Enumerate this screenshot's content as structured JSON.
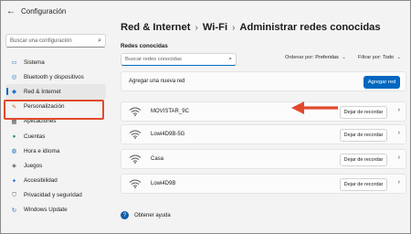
{
  "window": {
    "title": "Configuración",
    "back_glyph": "←"
  },
  "sidebar": {
    "search_placeholder": "Buscar una configuración",
    "items": [
      {
        "label": "Sistema",
        "icon": "monitor-icon",
        "glyph": "▭",
        "color": "#2b79d1"
      },
      {
        "label": "Bluetooth y dispositivos",
        "icon": "bluetooth-icon",
        "glyph": "◎",
        "color": "#2b79d1"
      },
      {
        "label": "Red & Internet",
        "icon": "wifi-diamond-icon",
        "glyph": "◆",
        "color": "#1d6fc7",
        "active": true
      },
      {
        "label": "Personalización",
        "icon": "brush-icon",
        "glyph": "✎",
        "color": "#c46a2a"
      },
      {
        "label": "Aplicaciones",
        "icon": "apps-icon",
        "glyph": "▦",
        "color": "#5a5a5a"
      },
      {
        "label": "Cuentas",
        "icon": "person-icon",
        "glyph": "●",
        "color": "#2f9e5a"
      },
      {
        "label": "Hora e idioma",
        "icon": "globe-clock-icon",
        "glyph": "◍",
        "color": "#1d6fc7"
      },
      {
        "label": "Juegos",
        "icon": "controller-icon",
        "glyph": "◈",
        "color": "#5a5a5a"
      },
      {
        "label": "Accesibilidad",
        "icon": "accessibility-icon",
        "glyph": "✦",
        "color": "#1d6fc7"
      },
      {
        "label": "Privacidad y seguridad",
        "icon": "shield-icon",
        "glyph": "⛉",
        "color": "#5a5a5a"
      },
      {
        "label": "Windows Update",
        "icon": "update-icon",
        "glyph": "↻",
        "color": "#1d6fc7"
      }
    ]
  },
  "main": {
    "breadcrumb": [
      "Red & Internet",
      "Wi-Fi",
      "Administrar redes conocidas"
    ],
    "breadcrumb_sep": "›",
    "section_label": "Redes conocidas",
    "filter_placeholder": "Buscar redes conocidas",
    "sort_label": "Ordenar por:",
    "sort_value": "Preferidas",
    "filter_label": "Filtrar por:",
    "filter_value": "Todo",
    "add_label": "Agregar una nueva red",
    "add_button": "Agregar red",
    "networks": [
      {
        "name": "MOVISTAR_9C",
        "forget": "Dejar de recordar"
      },
      {
        "name": "Lowi4D9B-5G",
        "forget": "Dejar de recordar"
      },
      {
        "name": "Casa",
        "forget": "Dejar de recordar"
      },
      {
        "name": "Lowi4D9B",
        "forget": "Dejar de recordar"
      }
    ],
    "help_label": "Obtener ayuda"
  },
  "colors": {
    "accent": "#0067c0",
    "highlight": "#e04a2c"
  }
}
